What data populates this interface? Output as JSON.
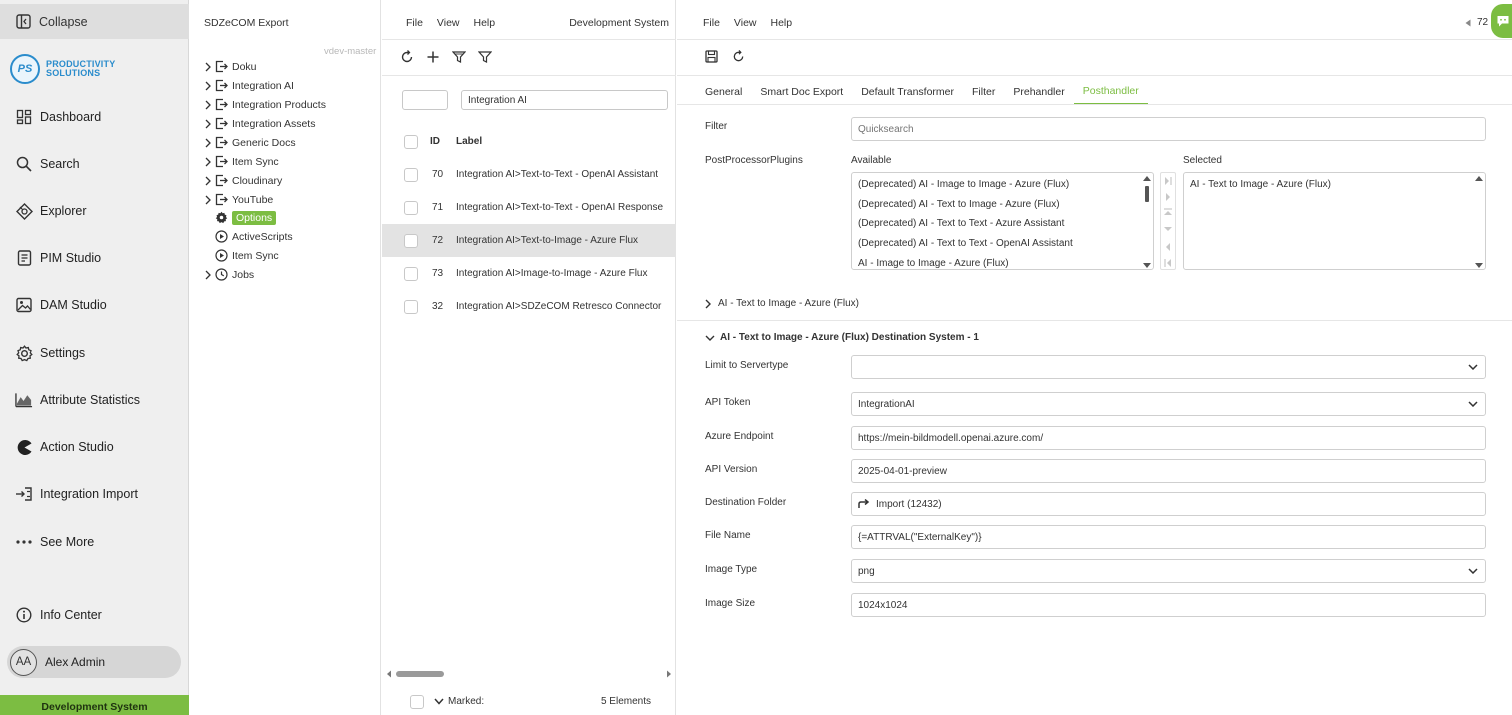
{
  "nav": {
    "collapse": "Collapse",
    "logo": {
      "initials": "PS",
      "line1": "PRODUCTIVITY",
      "line2": "SOLUTIONS"
    },
    "items": [
      {
        "label": "Dashboard",
        "icon": "dashboard-icon"
      },
      {
        "label": "Search",
        "icon": "search-icon"
      },
      {
        "label": "Explorer",
        "icon": "explorer-icon"
      },
      {
        "label": "PIM Studio",
        "icon": "pim-icon"
      },
      {
        "label": "DAM Studio",
        "icon": "image-icon"
      },
      {
        "label": "Settings",
        "icon": "gear-icon"
      },
      {
        "label": "Attribute Statistics",
        "icon": "chart-icon"
      },
      {
        "label": "Action Studio",
        "icon": "pacman-icon"
      },
      {
        "label": "Integration Import",
        "icon": "import-icon"
      },
      {
        "label": "See More",
        "icon": "more-icon"
      }
    ],
    "info_center": "Info Center",
    "user": {
      "initials": "AA",
      "name": "Alex Admin"
    },
    "env": "Development System"
  },
  "tree": {
    "title": "SDZeCOM Export",
    "branch": "vdev-master",
    "items": [
      {
        "label": "Doku",
        "icon": "export-icon",
        "expandable": true
      },
      {
        "label": "Integration AI",
        "icon": "export-icon",
        "expandable": true
      },
      {
        "label": "Integration Products",
        "icon": "export-icon",
        "expandable": true
      },
      {
        "label": "Integration Assets",
        "icon": "export-icon",
        "expandable": true
      },
      {
        "label": "Generic Docs",
        "icon": "export-icon",
        "expandable": true
      },
      {
        "label": "Item Sync",
        "icon": "export-icon",
        "expandable": true
      },
      {
        "label": "Cloudinary",
        "icon": "export-icon",
        "expandable": true
      },
      {
        "label": "YouTube",
        "icon": "export-icon",
        "expandable": true
      },
      {
        "label": "Options",
        "icon": "gear-icon",
        "expandable": false
      },
      {
        "label": "ActiveScripts",
        "icon": "play-icon",
        "expandable": false
      },
      {
        "label": "Item Sync",
        "icon": "play-icon",
        "expandable": false
      },
      {
        "label": "Jobs",
        "icon": "clock-icon",
        "expandable": true
      }
    ]
  },
  "list": {
    "menu": [
      "File",
      "View",
      "Help"
    ],
    "env": "Development System",
    "filter_value": "Integration AI",
    "filter_id_value": "",
    "col_id": "ID",
    "col_label": "Label",
    "rows": [
      {
        "id": "70",
        "label": "Integration AI>Text-to-Text - OpenAI Assistant"
      },
      {
        "id": "71",
        "label": "Integration AI>Text-to-Text - OpenAI Response"
      },
      {
        "id": "72",
        "label": "Integration AI>Text-to-Image - Azure Flux"
      },
      {
        "id": "73",
        "label": "Integration AI>Image-to-Image - Azure Flux"
      },
      {
        "id": "32",
        "label": "Integration AI>SDZeCOM Retresco Connector"
      }
    ],
    "selected_index": 2,
    "marked_label": "Marked:",
    "count": "5 Elements"
  },
  "detail": {
    "menu": [
      "File",
      "View",
      "Help"
    ],
    "corner_value": "72",
    "tabs": [
      "General",
      "Smart Doc Export",
      "Default Transformer",
      "Filter",
      "Prehandler",
      "Posthandler"
    ],
    "active_tab": 5,
    "filter_label": "Filter",
    "filter_placeholder": "Quicksearch",
    "plugins_label": "PostProcessorPlugins",
    "available_label": "Available",
    "selected_label": "Selected",
    "available": [
      "(Deprecated) AI - Image to Image - Azure (Flux)",
      "(Deprecated) AI - Text to Image - Azure (Flux)",
      "(Deprecated) AI - Text to Text - Azure Assistant",
      "(Deprecated) AI - Text to Text - OpenAI Assistant",
      "AI - Image to Image - Azure (Flux)"
    ],
    "selected": [
      "AI - Text to Image - Azure (Flux)"
    ],
    "section_collapsed": "AI - Text to Image - Azure (Flux)",
    "section_expanded": "AI - Text to Image - Azure (Flux) Destination System - 1",
    "fields": [
      {
        "label": "Limit to Servertype",
        "value": "",
        "type": "select"
      },
      {
        "label": "API Token",
        "value": "IntegrationAI",
        "type": "select"
      },
      {
        "label": "Azure Endpoint",
        "value": "https://mein-bildmodell.openai.azure.com/",
        "type": "text"
      },
      {
        "label": "API Version",
        "value": "2025-04-01-preview",
        "type": "text"
      },
      {
        "label": "Destination Folder",
        "value": "Import (12432)",
        "type": "link"
      },
      {
        "label": "File Name",
        "value": "{=ATTRVAL(\"ExternalKey\")}",
        "type": "text"
      },
      {
        "label": "Image Type",
        "value": "png",
        "type": "select"
      },
      {
        "label": "Image Size",
        "value": "1024x1024",
        "type": "text"
      }
    ]
  },
  "colors": {
    "accent": "#7cbd42",
    "brand": "#2a8ccc",
    "nav_bg": "#efefef",
    "selected_row": "#e3e3e3"
  }
}
